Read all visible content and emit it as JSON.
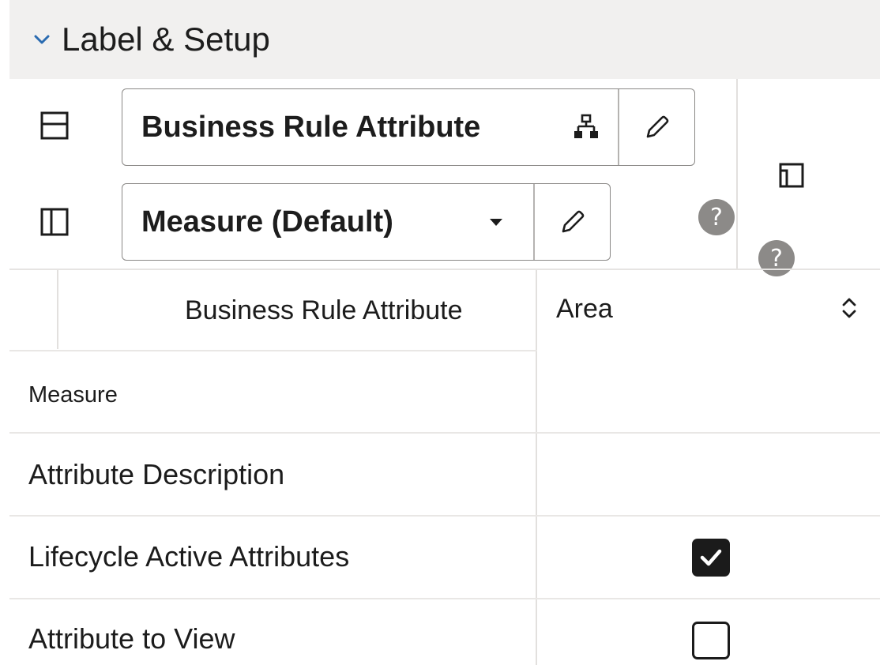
{
  "section": {
    "title": "Label & Setup",
    "chevron_icon": "chevron-down-icon"
  },
  "rows": {
    "row1": {
      "icon": "layout-top-panel-icon",
      "value": "Business Rule Attribute",
      "hierarchy_icon": "hierarchy-icon",
      "edit_icon": "pencil-icon"
    },
    "row2": {
      "icon": "layout-side-panel-icon",
      "value": "Measure (Default)",
      "dropdown_icon": "caret-down-icon",
      "edit_icon": "pencil-icon"
    }
  },
  "side": {
    "layout_icon": "layout-corner-panel-icon",
    "help_label": "?"
  },
  "table": {
    "header_attr": "Business Rule Attribute",
    "header_value": "Area",
    "sort_icon": "sort-updown-icon",
    "rows": [
      {
        "label": "Measure",
        "value": ""
      },
      {
        "label": "Attribute Description",
        "value": ""
      },
      {
        "label": "Lifecycle Active Attributes",
        "checked": true
      },
      {
        "label": "Attribute to View",
        "checked": false
      }
    ]
  },
  "colors": {
    "header_bg": "#f1f0ef",
    "border": "#8a8886",
    "help_bg": "#8c8a88",
    "checkbox": "#1b1b1b"
  }
}
